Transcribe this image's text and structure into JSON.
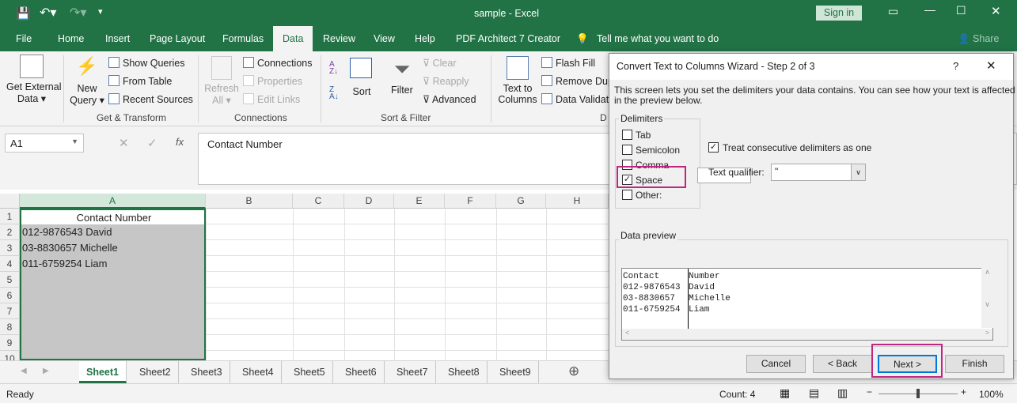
{
  "title": {
    "doc": "sample  -  Excel",
    "signin": "Sign in"
  },
  "tabs": [
    "File",
    "Home",
    "Insert",
    "Page Layout",
    "Formulas",
    "Data",
    "Review",
    "View",
    "Help",
    "PDF Architect 7 Creator"
  ],
  "tell_me": "Tell me what you want to do",
  "share": "Share",
  "ribbon": {
    "get_external": [
      "Get External",
      "Data ▾"
    ],
    "new_query": [
      "New",
      "Query ▾"
    ],
    "show_queries": "Show Queries",
    "from_table": "From Table",
    "recent_sources": "Recent Sources",
    "refresh": [
      "Refresh",
      "All ▾"
    ],
    "connections": "Connections",
    "properties": "Properties",
    "edit_links": "Edit Links",
    "sort": "Sort",
    "filter": "Filter",
    "clear": "Clear",
    "reapply": "Reapply",
    "advanced": "Advanced",
    "text_to_columns": [
      "Text to",
      "Columns"
    ],
    "flash_fill": "Flash Fill",
    "remove_dup": "Remove Dup",
    "data_validation": "Data Validatio",
    "groups": [
      "Get & Transform",
      "Connections",
      "Sort & Filter",
      "D"
    ]
  },
  "formula": {
    "namebox": "A1",
    "value": "Contact Number"
  },
  "columns": [
    "A",
    "B",
    "C",
    "D",
    "E",
    "F",
    "G",
    "H"
  ],
  "rows": [
    "1",
    "2",
    "3",
    "4",
    "5",
    "6",
    "7",
    "8",
    "9",
    "10"
  ],
  "cells": [
    "Contact Number",
    "012-9876543 David",
    "03-8830657 Michelle",
    "011-6759254 Liam"
  ],
  "sheets": [
    "Sheet1",
    "Sheet2",
    "Sheet3",
    "Sheet4",
    "Sheet5",
    "Sheet6",
    "Sheet7",
    "Sheet8",
    "Sheet9"
  ],
  "status": {
    "ready": "Ready",
    "count": "Count: 4",
    "zoom": "100%"
  },
  "dialog": {
    "title": "Convert Text to Columns Wizard - Step 2 of 3",
    "help": "?",
    "desc1": "This screen lets you set the delimiters your data contains.  You can see how your text is affected",
    "desc2": "in the preview below.",
    "delimiters_label": "Delimiters",
    "delimiters": [
      {
        "label": "Tab",
        "checked": false
      },
      {
        "label": "Semicolon",
        "checked": false
      },
      {
        "label": "Comma",
        "checked": false
      },
      {
        "label": "Space",
        "checked": true
      },
      {
        "label": "Other:",
        "checked": false
      }
    ],
    "consecutive": {
      "label": "Treat consecutive delimiters as one",
      "checked": true
    },
    "qualifier_label": "Text qualifier:",
    "qualifier_value": "\"",
    "preview_label": "Data preview",
    "preview": [
      [
        "Contact",
        "Number"
      ],
      [
        "012-9876543",
        "David"
      ],
      [
        "03-8830657",
        "Michelle"
      ],
      [
        "011-6759254",
        "Liam"
      ]
    ],
    "buttons": {
      "cancel": "Cancel",
      "back": "< Back",
      "next": "Next >",
      "finish": "Finish"
    },
    "highlight_color": "#c0267e"
  },
  "colors": {
    "excel_green": "#217346"
  }
}
